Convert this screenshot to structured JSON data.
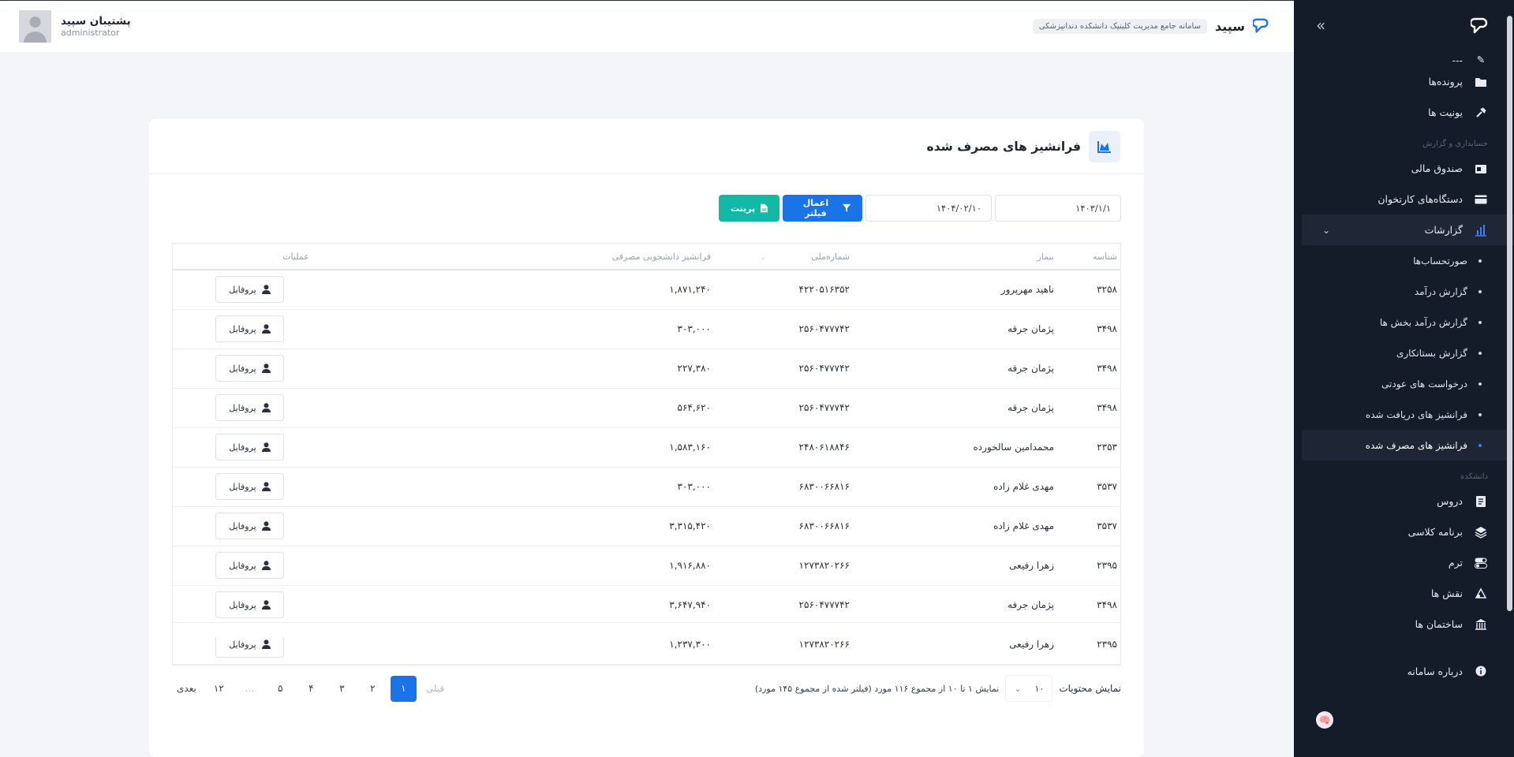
{
  "app": {
    "brand_name": "سپید",
    "brand_subtitle": "سامانه جامع مدیریت کلینیک دانشکده دندانپزشکی",
    "user_name": "پشتیبان سپید",
    "user_role": "administrator"
  },
  "sidebar": {
    "partial_label": "---",
    "items_top": [
      {
        "label": "پرونده‌ها",
        "icon": "folder-icon"
      },
      {
        "label": "یونیت ها",
        "icon": "dental-unit-icon"
      }
    ],
    "section_finance": "حسابداری و گزارش",
    "items_finance": [
      {
        "label": "صندوق مالی",
        "icon": "cash-register-icon"
      },
      {
        "label": "دستگاه‌های کارتخوان",
        "icon": "card-reader-icon"
      }
    ],
    "reports_label": "گزارشات",
    "report_subitems": [
      "صورتحساب‌ها",
      "گزارش درآمد",
      "گزارش درآمد بخش ها",
      "گزارش بستانکاری",
      "درخواست های عودتی",
      "فرانشیز های دریافت شده",
      "فرانشیز های مصرف شده"
    ],
    "section_faculty": "دانشکده",
    "items_faculty": [
      {
        "label": "دروس",
        "icon": "book-icon"
      },
      {
        "label": "برنامه کلاسی",
        "icon": "layers-icon"
      },
      {
        "label": "ترم",
        "icon": "toggle-icon"
      },
      {
        "label": "نقش ها",
        "icon": "shapes-icon"
      },
      {
        "label": "ساختمان ها",
        "icon": "building-icon"
      }
    ],
    "item_about": "درباره سامانه"
  },
  "page": {
    "title": "فرانشیز های مصرف شده",
    "date_from": "۱۴۰۳/۱/۱",
    "date_to": "۱۴۰۴/۰۲/۱۰",
    "filter_button": "اعمال فیلتر",
    "print_button": "پرینت"
  },
  "table": {
    "headers": [
      "شناسه",
      "بیمار",
      "شماره‌ملی",
      "فرانشیز دانشجویی مصرفی",
      "عملیات"
    ],
    "action_label": "پروفایل",
    "rows": [
      {
        "id": "۳۲۵۸",
        "patient": "ناهید مهرپرور",
        "national_id": "۴۲۲۰۵۱۶۳۵۲",
        "franchise": "۱,۸۷۱,۲۴۰"
      },
      {
        "id": "۳۴۹۸",
        "patient": "پژمان جرقه",
        "national_id": "۲۵۶۰۴۷۷۷۴۲",
        "franchise": "۳۰۳,۰۰۰"
      },
      {
        "id": "۳۴۹۸",
        "patient": "پژمان جرقه",
        "national_id": "۲۵۶۰۴۷۷۷۴۲",
        "franchise": "۲۲۷,۳۸۰"
      },
      {
        "id": "۳۴۹۸",
        "patient": "پژمان جرقه",
        "national_id": "۲۵۶۰۴۷۷۷۴۲",
        "franchise": "۵۶۴,۶۲۰"
      },
      {
        "id": "۲۳۵۳",
        "patient": "محمدامین سالخورده",
        "national_id": "۲۴۸۰۶۱۸۸۴۶",
        "franchise": "۱,۵۸۳,۱۶۰"
      },
      {
        "id": "۳۵۳۷",
        "patient": "مهدی غلام زاده",
        "national_id": "۶۸۳۰۰۶۶۸۱۶",
        "franchise": "۳۰۳,۰۰۰"
      },
      {
        "id": "۳۵۳۷",
        "patient": "مهدی غلام زاده",
        "national_id": "۶۸۳۰۰۶۶۸۱۶",
        "franchise": "۳,۳۱۵,۴۲۰"
      },
      {
        "id": "۲۳۹۵",
        "patient": "زهرا رفیعی",
        "national_id": "۱۲۷۳۸۲۰۲۶۶",
        "franchise": "۱,۹۱۶,۸۸۰"
      },
      {
        "id": "۳۴۹۸",
        "patient": "پژمان جرقه",
        "national_id": "۲۵۶۰۴۷۷۷۴۲",
        "franchise": "۳,۶۴۷,۹۴۰"
      },
      {
        "id": "۲۳۹۵",
        "patient": "زهرا رفیعی",
        "national_id": "۱۲۷۳۸۲۰۲۶۶",
        "franchise": "۱,۲۳۷,۳۰۰"
      }
    ]
  },
  "footer": {
    "show_label": "نمایش محتویات",
    "page_size": "۱۰",
    "info": "نمایش ۱ تا ۱۰ از مجموع ۱۱۶ مورد (فیلتر شده از مجموع ۱۴۵ مورد)",
    "prev": "قبلی",
    "next": "بعدی",
    "pages": [
      "1",
      "2",
      "3",
      "4",
      "5"
    ],
    "ellipsis": "…",
    "last_page": "۱۲"
  },
  "colors": {
    "sidebar_bg": "#141b29",
    "primary": "#1a74e8",
    "print": "#14b8a6"
  }
}
